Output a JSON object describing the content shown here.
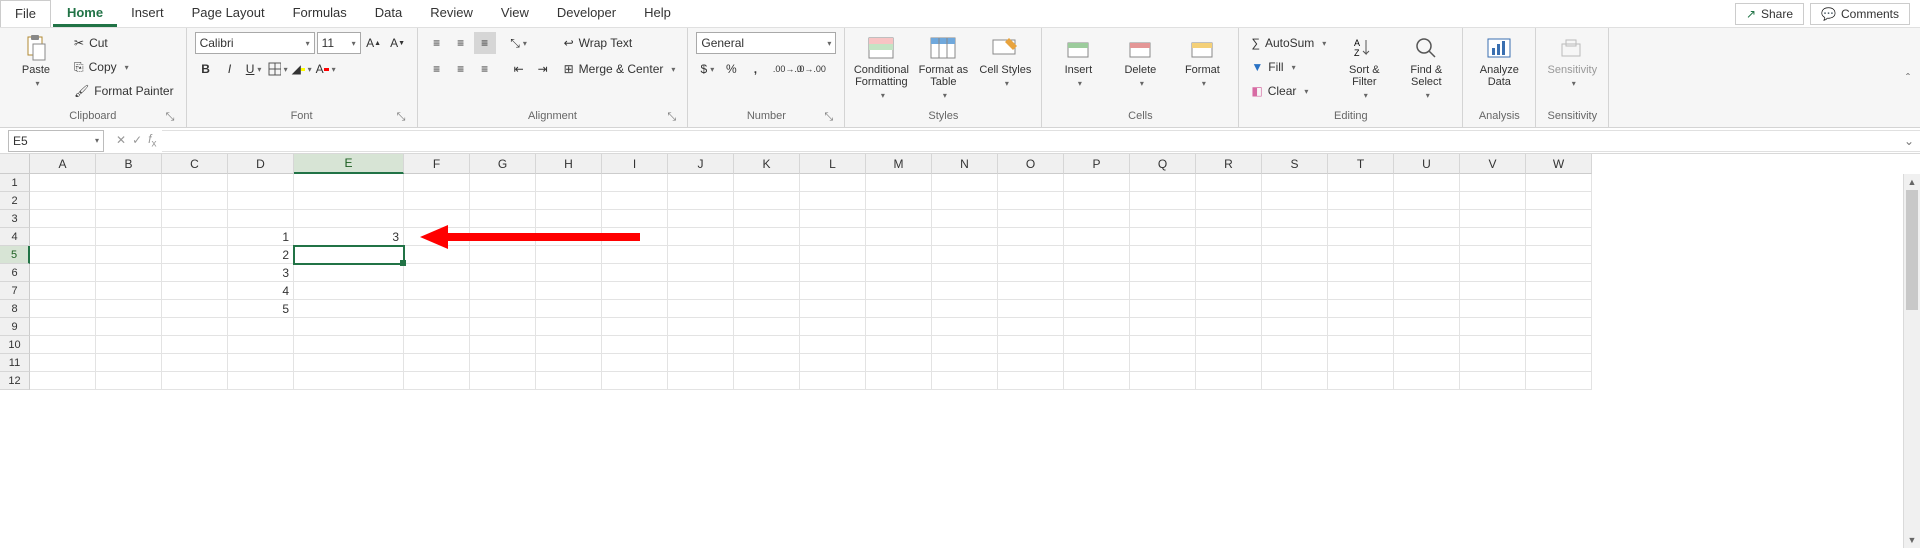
{
  "tabs": {
    "file": "File",
    "items": [
      "Home",
      "Insert",
      "Page Layout",
      "Formulas",
      "Data",
      "Review",
      "View",
      "Developer",
      "Help"
    ],
    "active": "Home",
    "share": "Share",
    "comments": "Comments"
  },
  "ribbon": {
    "clipboard": {
      "label": "Clipboard",
      "paste": "Paste",
      "cut": "Cut",
      "copy": "Copy",
      "format_painter": "Format Painter"
    },
    "font": {
      "label": "Font",
      "name": "Calibri",
      "size": "11"
    },
    "alignment": {
      "label": "Alignment",
      "wrap": "Wrap Text",
      "merge": "Merge & Center"
    },
    "number": {
      "label": "Number",
      "format": "General"
    },
    "styles": {
      "label": "Styles",
      "cond": "Conditional Formatting",
      "table": "Format as Table",
      "cell": "Cell Styles"
    },
    "cells": {
      "label": "Cells",
      "insert": "Insert",
      "delete": "Delete",
      "format": "Format"
    },
    "editing": {
      "label": "Editing",
      "autosum": "AutoSum",
      "fill": "Fill",
      "clear": "Clear",
      "sort": "Sort & Filter",
      "find": "Find & Select"
    },
    "analysis": {
      "label": "Analysis",
      "analyze": "Analyze Data"
    },
    "sensitivity": {
      "label": "Sensitivity",
      "btn": "Sensitivity"
    }
  },
  "formula_bar": {
    "cell_ref": "E5",
    "formula": ""
  },
  "grid": {
    "columns": [
      "A",
      "B",
      "C",
      "D",
      "E",
      "F",
      "G",
      "H",
      "I",
      "J",
      "K",
      "L",
      "M",
      "N",
      "O",
      "P",
      "Q",
      "R",
      "S",
      "T",
      "U",
      "V",
      "W"
    ],
    "row_count": 12,
    "active_col": "E",
    "active_row": 5,
    "cells": {
      "D4": "1",
      "D5": "2",
      "D6": "3",
      "D7": "4",
      "D8": "5",
      "E4": "3"
    }
  }
}
